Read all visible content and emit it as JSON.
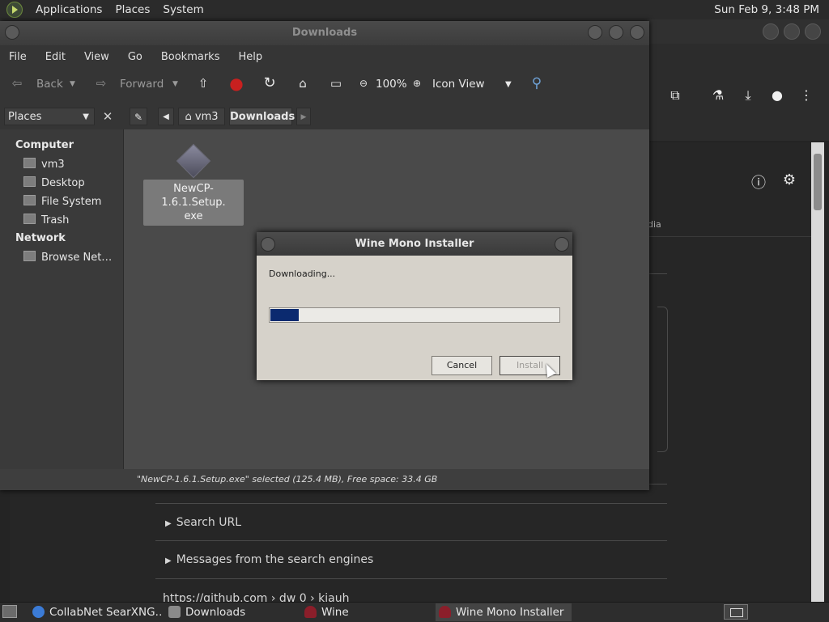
{
  "top_panel": {
    "menus": [
      "Applications",
      "Places",
      "System"
    ],
    "clock": "Sun Feb  9,  3:48 PM"
  },
  "browser": {
    "tab_partial": "dia",
    "rows": [
      "Search URL",
      "Messages from the search engines"
    ],
    "url_partial": "https://github.com › dw 0 › kiauh"
  },
  "file_manager": {
    "title": "Downloads",
    "menubar": [
      "File",
      "Edit",
      "View",
      "Go",
      "Bookmarks",
      "Help"
    ],
    "toolbar": {
      "back_label": "Back",
      "forward_label": "Forward",
      "zoom": "100%",
      "view_mode": "Icon View"
    },
    "locbar": {
      "places_label": "Places",
      "crumbs": [
        "vm3",
        "Downloads"
      ]
    },
    "sidebar": {
      "computer_header": "Computer",
      "computer_items": [
        "vm3",
        "Desktop",
        "File System",
        "Trash"
      ],
      "network_header": "Network",
      "network_items": [
        "Browse Net…"
      ]
    },
    "files": [
      {
        "name_line1": "NewCP-1.6.1.Setup.",
        "name_line2": "exe"
      }
    ],
    "status": "\"NewCP-1.6.1.Setup.exe\" selected (125.4 MB), Free space: 33.4 GB"
  },
  "dialog": {
    "title": "Wine Mono Installer",
    "status": "Downloading...",
    "progress": 0.098,
    "cancel_label": "Cancel",
    "install_label": "Install"
  },
  "taskbar": {
    "tasks": [
      {
        "label": "CollabNet SearXNG…",
        "icon": "browser-icon"
      },
      {
        "label": "Downloads",
        "icon": "folder-icon"
      },
      {
        "label": "Wine",
        "icon": "wine-icon"
      },
      {
        "label": "Wine Mono Installer",
        "icon": "wine-icon"
      }
    ]
  },
  "colors": {
    "progress_fill": "#0b2a6f",
    "dialog_bg": "#d6d2ca"
  }
}
